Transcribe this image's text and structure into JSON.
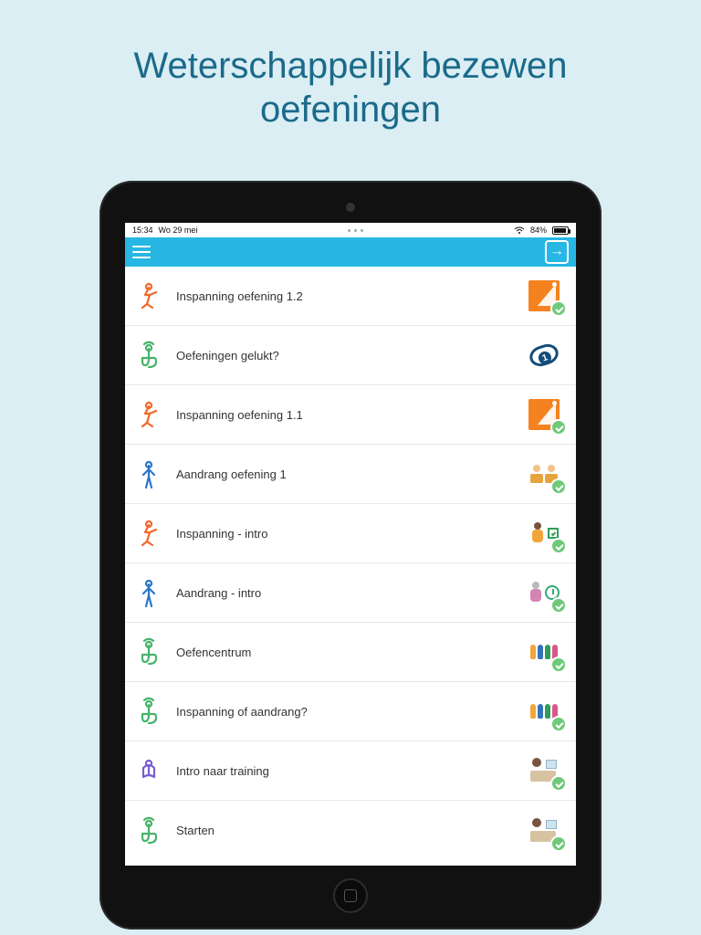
{
  "hero": {
    "line1": "Weterschappelijk bezewen",
    "line2": "oefeningen"
  },
  "statusbar": {
    "time": "15:34",
    "date": "Wo 29 mei",
    "battery_pct": "84%"
  },
  "colors": {
    "accent": "#27b7e5",
    "hero_text": "#1b6a8a"
  },
  "list": {
    "items": [
      {
        "label": "Inspanning oefening 1.2",
        "left_icon": "runner-icon",
        "left_tint": "orange",
        "thumb": "arrow-up-tile",
        "completed": true
      },
      {
        "label": "Oefeningen gelukt?",
        "left_icon": "tap-icon",
        "left_tint": "green",
        "thumb": "ring-1",
        "completed": false
      },
      {
        "label": "Inspanning oefening 1.1",
        "left_icon": "runner-icon",
        "left_tint": "orange",
        "thumb": "arrow-up-tile",
        "completed": true
      },
      {
        "label": "Aandrang oefening 1",
        "left_icon": "standing-icon",
        "left_tint": "blue",
        "thumb": "two-chairs",
        "completed": true
      },
      {
        "label": "Inspanning - intro",
        "left_icon": "runner-icon",
        "left_tint": "orange",
        "thumb": "person-check",
        "completed": true
      },
      {
        "label": "Aandrang - intro",
        "left_icon": "standing-icon",
        "left_tint": "blue",
        "thumb": "person-clock",
        "completed": true
      },
      {
        "label": "Oefencentrum",
        "left_icon": "tap-icon",
        "left_tint": "green",
        "thumb": "people-group",
        "completed": true
      },
      {
        "label": "Inspanning of aandrang?",
        "left_icon": "tap-icon",
        "left_tint": "green",
        "thumb": "people-group",
        "completed": true
      },
      {
        "label": "Intro naar training",
        "left_icon": "reading-icon",
        "left_tint": "purple",
        "thumb": "person-desk",
        "completed": true
      },
      {
        "label": "Starten",
        "left_icon": "tap-icon",
        "left_tint": "green",
        "thumb": "person-desk",
        "completed": true
      }
    ]
  }
}
